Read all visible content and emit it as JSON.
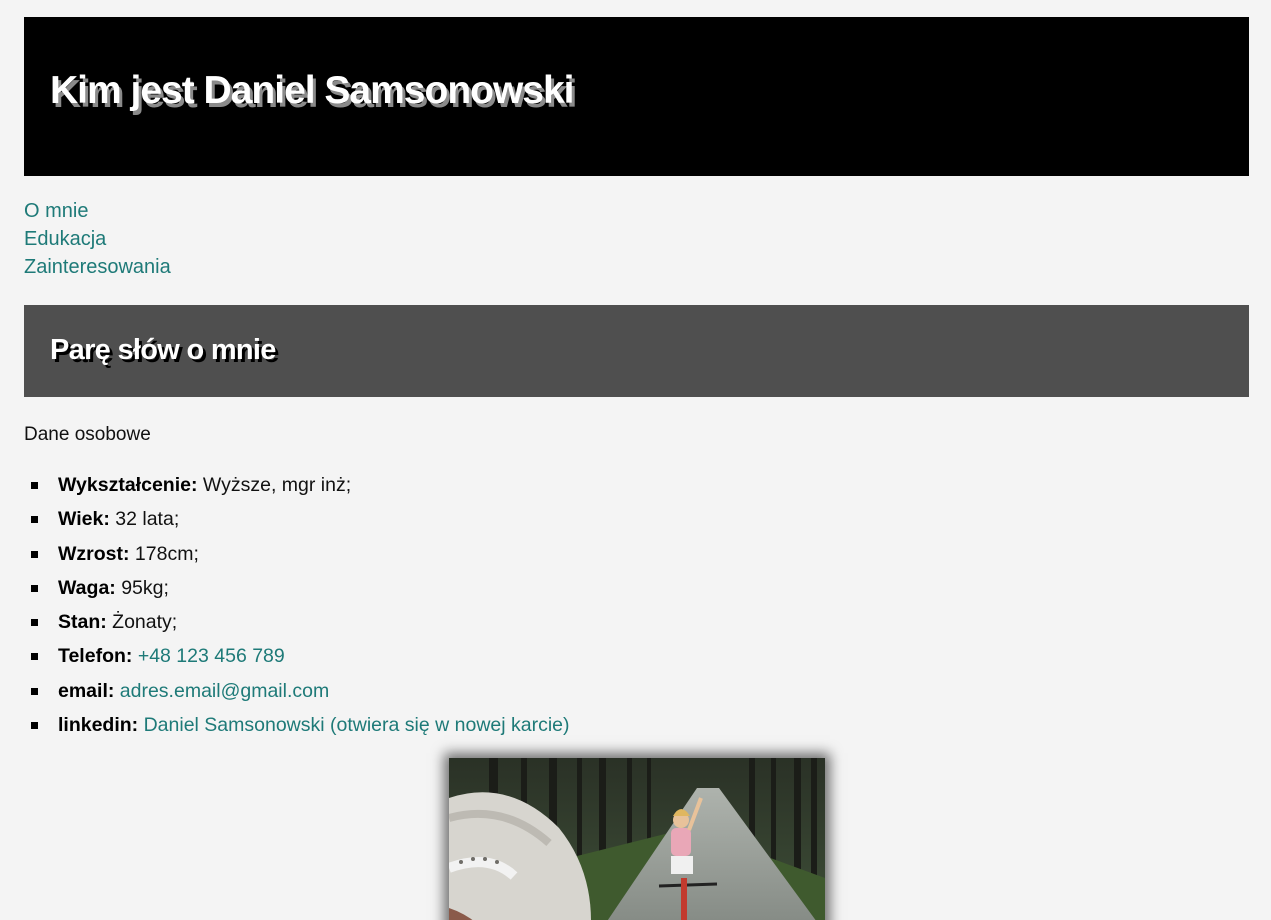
{
  "header": {
    "title": "Kim jest Daniel Samsonowski"
  },
  "nav": {
    "items": [
      {
        "label": "O mnie"
      },
      {
        "label": "Edukacja"
      },
      {
        "label": "Zainteresowania"
      }
    ]
  },
  "about": {
    "heading": "Parę słów o mnie",
    "intro": "Dane osobowe",
    "details": [
      {
        "key": "Wykształcenie:",
        "value": "Wyższe, mgr inż;"
      },
      {
        "key": "Wiek:",
        "value": "32 lata;"
      },
      {
        "key": "Wzrost:",
        "value": "178cm;"
      },
      {
        "key": "Waga:",
        "value": "95kg;"
      },
      {
        "key": "Stan:",
        "value": "Żonaty;"
      },
      {
        "key": "Telefon:",
        "value": "+48 123 456 789"
      },
      {
        "key": "email:",
        "value": "adres.email@gmail.com"
      },
      {
        "key": "linkedin:",
        "value": "Daniel Samsonowski (otwiera się w nowej karcie)"
      }
    ]
  },
  "colors": {
    "link": "#1e7a78",
    "banner_bg": "#000000",
    "section_bg": "#4f4f4f",
    "page_bg": "#f4f4f4"
  },
  "icons": {
    "list_bullet": "square-bullet-icon"
  }
}
